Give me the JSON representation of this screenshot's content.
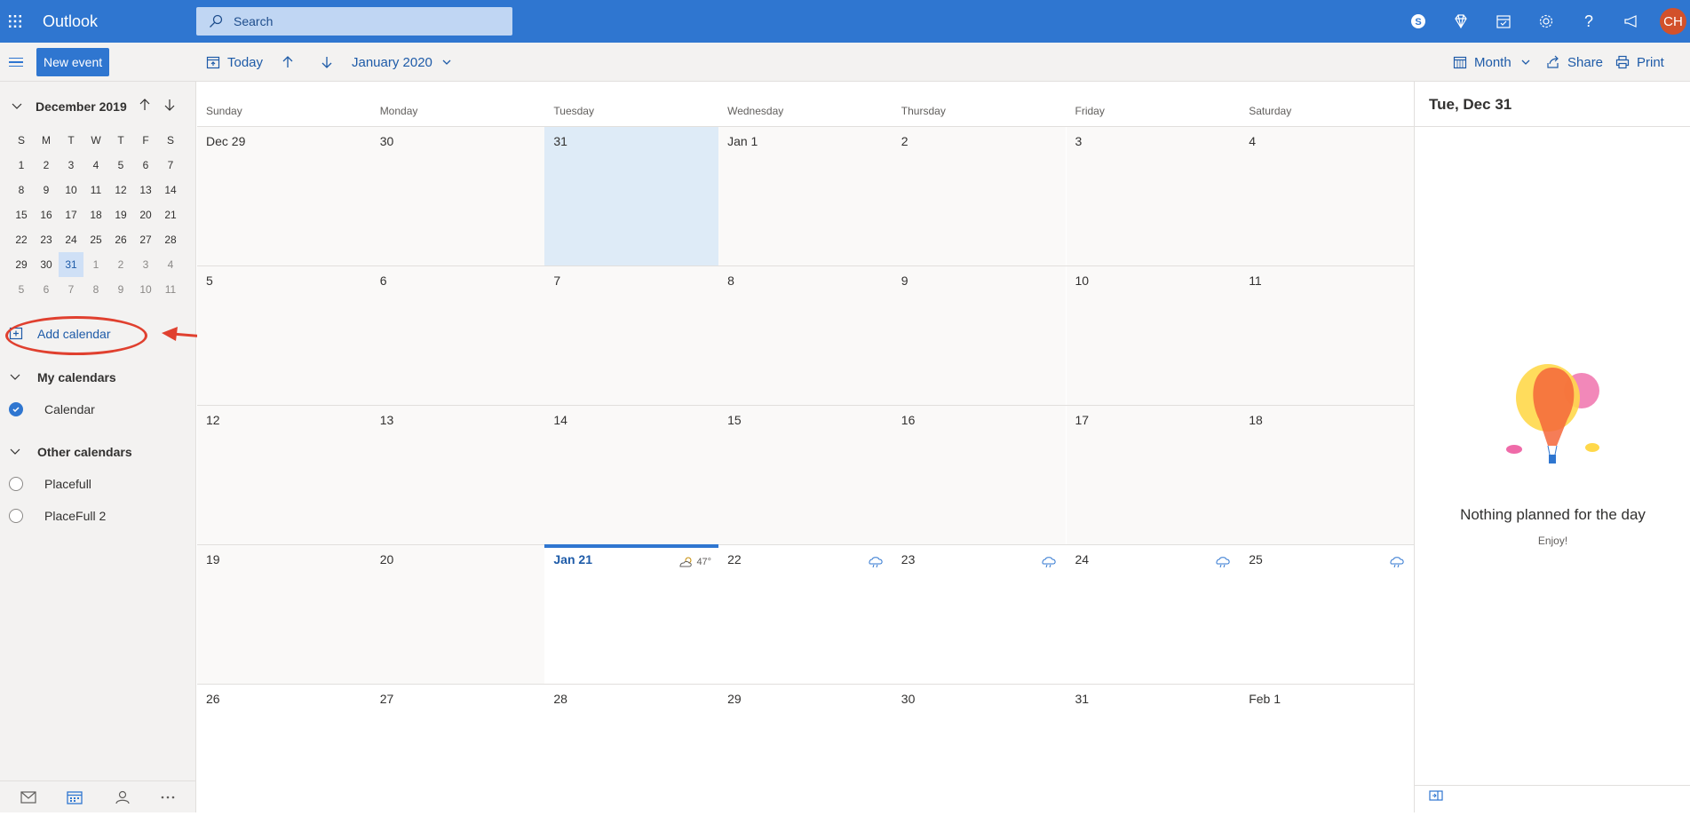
{
  "header": {
    "app_title": "Outlook",
    "search_placeholder": "Search",
    "avatar_initials": "CH",
    "icons": [
      "skype-icon",
      "diamond-icon",
      "calendar-check-icon",
      "gear-icon",
      "help-icon",
      "megaphone-icon"
    ]
  },
  "toolbar": {
    "new_event": "New event",
    "today": "Today",
    "period": "January 2020",
    "view": "Month",
    "share": "Share",
    "print": "Print"
  },
  "mini_calendar": {
    "title": "December 2019",
    "weekday_headers": [
      "S",
      "M",
      "T",
      "W",
      "T",
      "F",
      "S"
    ],
    "rows": [
      [
        {
          "d": "1"
        },
        {
          "d": "2"
        },
        {
          "d": "3"
        },
        {
          "d": "4"
        },
        {
          "d": "5"
        },
        {
          "d": "6"
        },
        {
          "d": "7"
        }
      ],
      [
        {
          "d": "8"
        },
        {
          "d": "9"
        },
        {
          "d": "10"
        },
        {
          "d": "11"
        },
        {
          "d": "12"
        },
        {
          "d": "13"
        },
        {
          "d": "14"
        }
      ],
      [
        {
          "d": "15"
        },
        {
          "d": "16"
        },
        {
          "d": "17"
        },
        {
          "d": "18"
        },
        {
          "d": "19"
        },
        {
          "d": "20"
        },
        {
          "d": "21"
        }
      ],
      [
        {
          "d": "22"
        },
        {
          "d": "23"
        },
        {
          "d": "24"
        },
        {
          "d": "25"
        },
        {
          "d": "26"
        },
        {
          "d": "27"
        },
        {
          "d": "28"
        }
      ],
      [
        {
          "d": "29"
        },
        {
          "d": "30"
        },
        {
          "d": "31",
          "selected": true
        },
        {
          "d": "1",
          "dim": true
        },
        {
          "d": "2",
          "dim": true
        },
        {
          "d": "3",
          "dim": true
        },
        {
          "d": "4",
          "dim": true
        }
      ],
      [
        {
          "d": "5",
          "dim": true
        },
        {
          "d": "6",
          "dim": true
        },
        {
          "d": "7",
          "dim": true
        },
        {
          "d": "8",
          "dim": true
        },
        {
          "d": "9",
          "dim": true
        },
        {
          "d": "10",
          "dim": true
        },
        {
          "d": "11",
          "dim": true
        }
      ]
    ]
  },
  "sidebar": {
    "add_calendar": "Add calendar",
    "my_calendars_title": "My calendars",
    "my_calendars": [
      {
        "name": "Calendar",
        "checked": true
      }
    ],
    "other_calendars_title": "Other calendars",
    "other_calendars": [
      {
        "name": "Placefull",
        "checked": false
      },
      {
        "name": "PlaceFull 2",
        "checked": false
      }
    ],
    "bottom_nav": [
      "mail-icon",
      "calendar-icon",
      "people-icon",
      "more-icon"
    ]
  },
  "month": {
    "weekdays": [
      "Sunday",
      "Monday",
      "Tuesday",
      "Wednesday",
      "Thursday",
      "Friday",
      "Saturday"
    ],
    "weeks": [
      [
        {
          "d": "Dec 29"
        },
        {
          "d": "30"
        },
        {
          "d": "31",
          "selected": true
        },
        {
          "d": "Jan 1"
        },
        {
          "d": "2"
        },
        {
          "d": "3"
        },
        {
          "d": "4"
        }
      ],
      [
        {
          "d": "5"
        },
        {
          "d": "6"
        },
        {
          "d": "7"
        },
        {
          "d": "8"
        },
        {
          "d": "9"
        },
        {
          "d": "10"
        },
        {
          "d": "11"
        }
      ],
      [
        {
          "d": "12"
        },
        {
          "d": "13"
        },
        {
          "d": "14"
        },
        {
          "d": "15"
        },
        {
          "d": "16"
        },
        {
          "d": "17"
        },
        {
          "d": "18"
        }
      ],
      [
        {
          "d": "19"
        },
        {
          "d": "20"
        },
        {
          "d": "Jan 21",
          "today": true,
          "future": true,
          "weather": "partly-cloudy",
          "temp": "47°"
        },
        {
          "d": "22",
          "future": true,
          "weather": "rain"
        },
        {
          "d": "23",
          "future": true,
          "weather": "rain"
        },
        {
          "d": "24",
          "future": true,
          "weather": "rain"
        },
        {
          "d": "25",
          "future": true,
          "weather": "rain"
        }
      ],
      [
        {
          "d": "26",
          "future": true
        },
        {
          "d": "27",
          "future": true
        },
        {
          "d": "28",
          "future": true
        },
        {
          "d": "29",
          "future": true
        },
        {
          "d": "30",
          "future": true
        },
        {
          "d": "31",
          "future": true
        },
        {
          "d": "Feb 1",
          "future": true
        }
      ]
    ]
  },
  "day_panel": {
    "title": "Tue, Dec 31",
    "empty_message": "Nothing planned for the day",
    "empty_sub": "Enjoy!"
  },
  "colors": {
    "brand": "#2f76d0",
    "selected_day": "#deebf7",
    "annotation": "#e0402f"
  }
}
